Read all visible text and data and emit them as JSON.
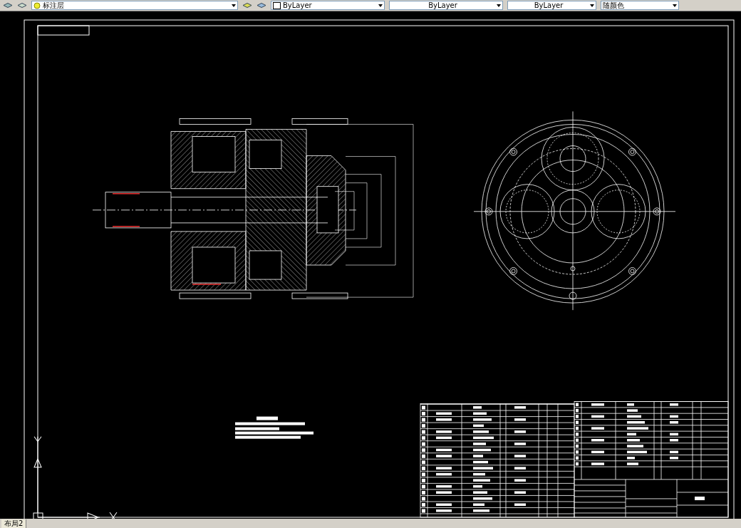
{
  "toolbar": {
    "layer": {
      "value": "标注层"
    },
    "dropdowns": [
      {
        "kind": "color",
        "value": "ByLayer"
      },
      {
        "kind": "linetype",
        "value": "ByLayer"
      },
      {
        "kind": "lineweight",
        "value": "ByLayer"
      },
      {
        "kind": "plotstyle",
        "value": "随颜色"
      }
    ]
  },
  "layout_tabs": [
    {
      "label": "布局2"
    }
  ]
}
